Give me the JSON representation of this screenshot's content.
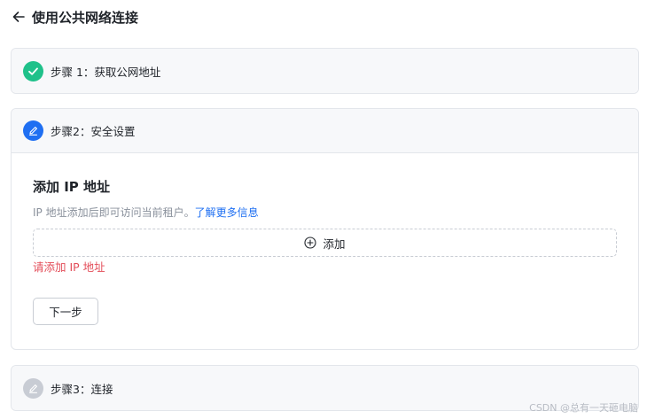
{
  "header": {
    "back_icon": "arrow-left-icon",
    "title": "使用公共网络连接"
  },
  "steps": [
    {
      "label": "步骤 1：获取公网地址",
      "status": "completed",
      "icon": "check-icon"
    },
    {
      "label": "步骤2：安全设置",
      "status": "active",
      "icon": "edit-icon"
    },
    {
      "label": "步骤3：连接",
      "status": "pending",
      "icon": "edit-icon"
    }
  ],
  "security": {
    "section_title": "添加 IP 地址",
    "description": "IP 地址添加后即可访问当前租户。",
    "learn_more_link": "了解更多信息",
    "add_label": "添加",
    "add_icon": "plus-circle-icon",
    "error_message": "请添加 IP 地址",
    "next_label": "下一步"
  },
  "watermark": "CSDN @总有一天砸电脑",
  "colors": {
    "completed": "#1fc18a",
    "active": "#1f6ff2",
    "pending": "#c8ccd4",
    "link": "#1f6ff2",
    "error": "#e34d59"
  }
}
